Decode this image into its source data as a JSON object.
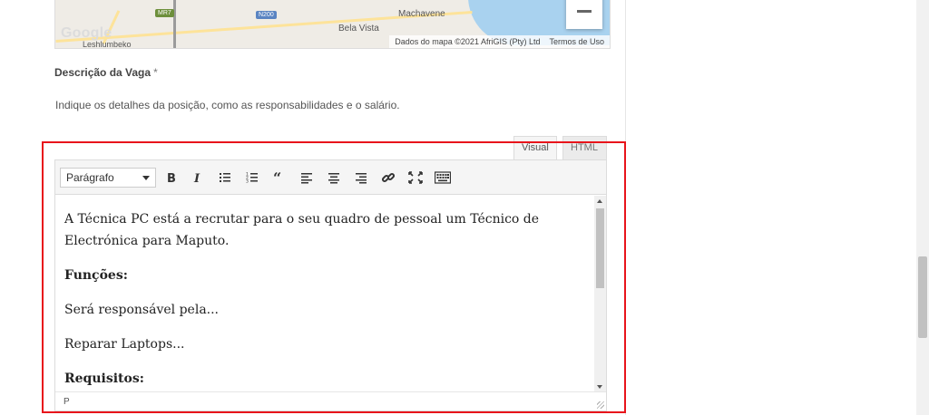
{
  "map": {
    "labels": {
      "machavene": "Machavene",
      "bela_vista": "Bela Vista",
      "leshlumbeko": "Leshlumbeko"
    },
    "shields": {
      "mr7": "MR7",
      "n200": "N200"
    },
    "logo_text": "Google",
    "attribution": "Dados do mapa ©2021 AfriGIS (Pty) Ltd",
    "terms": "Termos de Uso",
    "zoom_out_icon": "minus-icon"
  },
  "field": {
    "label": "Descrição da Vaga",
    "required_mark": "*",
    "description": "Indique os detalhes da posição, como as responsabilidades e o salário."
  },
  "editor": {
    "tabs": {
      "visual": "Visual",
      "html": "HTML"
    },
    "format_select": "Parágrafo",
    "toolbar_icons": [
      "bold-icon",
      "italic-icon",
      "bullet-list-icon",
      "numbered-list-icon",
      "blockquote-icon",
      "align-left-icon",
      "align-center-icon",
      "align-right-icon",
      "link-icon",
      "fullscreen-icon",
      "keyboard-icon"
    ],
    "content": {
      "p1": "A Técnica PC está a recrutar para o seu quadro de pessoal um Técnico de Electrónica para Maputo.",
      "h1": "Funções:",
      "p2": "Será responsável pela...",
      "p3": "Reparar Laptops...",
      "h2": "Requisitos:"
    },
    "status_path": "P"
  },
  "colors": {
    "highlight": "#e8141b",
    "water": "#a9d2ef"
  }
}
